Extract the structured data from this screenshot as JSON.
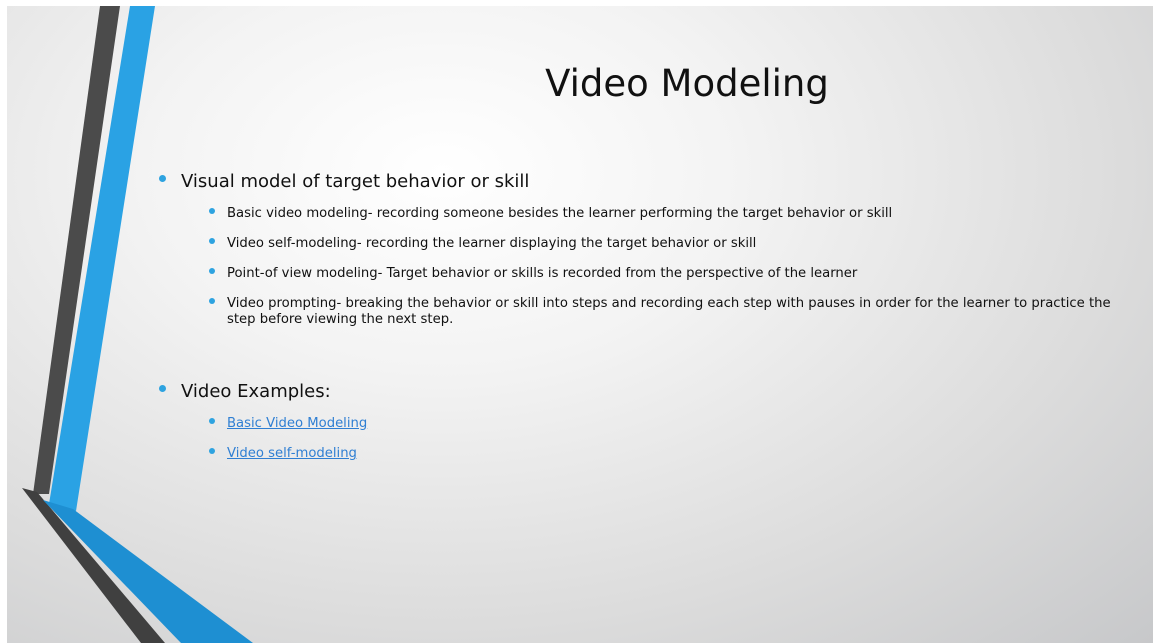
{
  "slide": {
    "title": "Video Modeling",
    "bullets": [
      {
        "text": "Visual model of target behavior or skill",
        "sub_items": [
          {
            "text": "Basic video modeling- recording someone besides the learner performing the target behavior or skill"
          },
          {
            "text": "Video self-modeling- recording the learner displaying the target behavior or skill"
          },
          {
            "text": "Point-of view modeling- Target behavior or skills is recorded from the perspective of the learner"
          },
          {
            "text": "Video prompting- breaking the behavior or skill into steps and recording each step with pauses in order for the learner to practice the step before viewing the next step."
          }
        ]
      },
      {
        "text": "Video Examples:",
        "links": [
          {
            "text": "Basic Video Modeling"
          },
          {
            "text": "Video self-modeling"
          }
        ]
      }
    ]
  },
  "colors": {
    "accent_blue": "#2ea3e0",
    "dark_stripe": "#4a4a4a",
    "link": "#2f7fd3"
  }
}
